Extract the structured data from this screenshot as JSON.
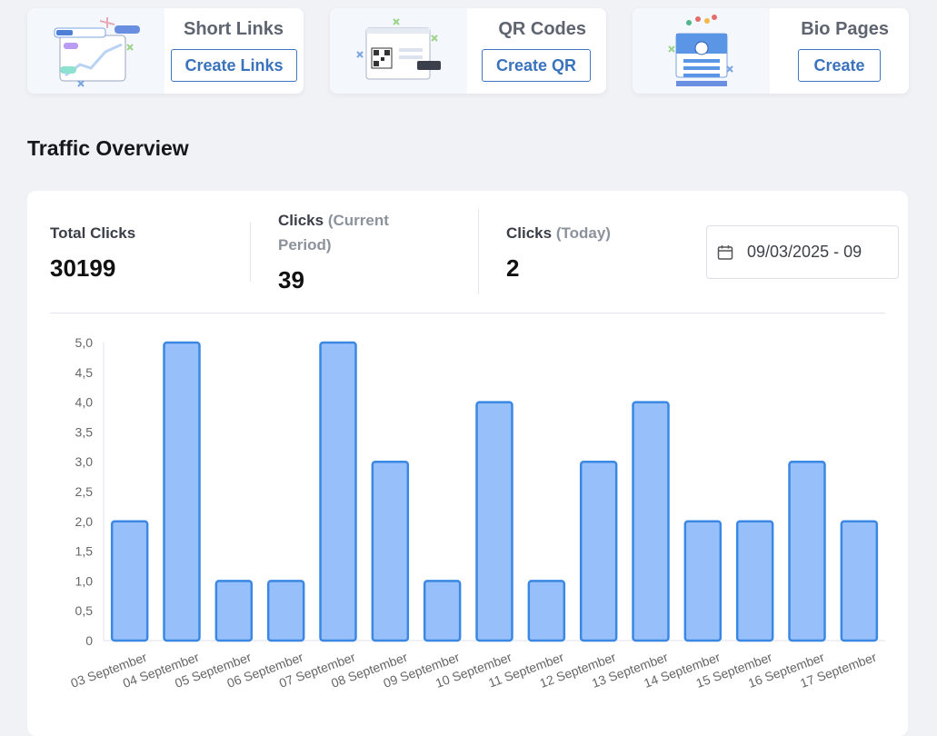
{
  "cards": [
    {
      "title": "Short Links",
      "button": "Create Links",
      "icon": "short-links-illustration"
    },
    {
      "title": "QR Codes",
      "button": "Create QR",
      "icon": "qr-codes-illustration"
    },
    {
      "title": "Bio Pages",
      "button": "Create",
      "icon": "bio-pages-illustration"
    }
  ],
  "section_title": "Traffic Overview",
  "stats": {
    "total_label": "Total Clicks",
    "total_value": "30199",
    "current_label": "Clicks",
    "current_paren": "(Current Period)",
    "current_value": "39",
    "today_label": "Clicks",
    "today_paren": "(Today)",
    "today_value": "2"
  },
  "date_range": {
    "value": "09/03/2025 - 09",
    "icon": "calendar-icon"
  },
  "colors": {
    "accent": "#3a72bc",
    "bar_fill": "#97c0fb",
    "bar_stroke": "#3a87e4"
  },
  "chart_data": {
    "type": "bar",
    "categories": [
      "03 September",
      "04 September",
      "05 September",
      "06 September",
      "07 September",
      "08 September",
      "09 September",
      "10 September",
      "11 September",
      "12 September",
      "13 September",
      "14 September",
      "15 September",
      "16 September",
      "17 September"
    ],
    "values": [
      2,
      5,
      1,
      1,
      5,
      3,
      1,
      4,
      1,
      3,
      4,
      2,
      2,
      3,
      2
    ],
    "ylim": [
      0,
      5
    ],
    "yticks": [
      "0",
      "0,5",
      "1,0",
      "1,5",
      "2,0",
      "2,5",
      "3,0",
      "3,5",
      "4,0",
      "4,5",
      "5,0"
    ],
    "grid": false,
    "legend": "none"
  }
}
